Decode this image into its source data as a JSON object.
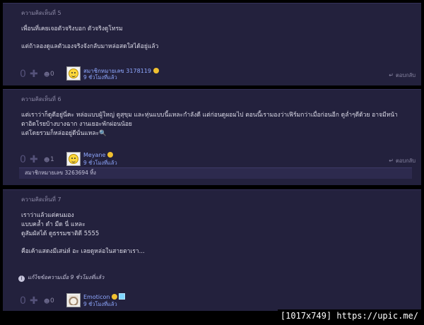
{
  "comments": [
    {
      "header": "ความคิดเห็นที่ 5",
      "lines": [
        "เพื่อนที่เคยเจอตัวจริงบอก ตัวจริงดูโทรม",
        "",
        "แต่ถ้าลองดูแลตัวเองจริงจังกลับมาหล่อสดใสได้อยู่แล้ว"
      ],
      "votes": "0",
      "emotion_count": "0",
      "username": "สมาชิกหมายเลข 3178119",
      "time": "9 ชั่วโมงที่แล้ว",
      "reply": "ตอบกลับ",
      "avatar": "smiley-avatar"
    },
    {
      "header": "ความคิดเห็นที่ 6",
      "lines": [
        "แต่เราว่าก็ดูดีอยู่นี่คะ หล่อแบบผู้ใหญ่ ดูสุขุม และหุ่นแบบนี้แหละกำลังดี แต่ก่อนดูผอมไป ตอนนี้เรามองว่าเฟิร์มกว่าเมื่อก่อนอีก ดูล่ำๆดีด้วย อาจมีหน้า",
        "ตาอิดโรยบ้างบางฉาก งานเยอะพักผ่อนน้อย",
        "แต่โดยรวมก็หล่ออยู่ดีนั่นแหละ🔍"
      ],
      "votes": "0",
      "emotion_count": "1",
      "username": "Meyane",
      "time": "9 ชั่วโมงที่แล้ว",
      "reply": "ตอบกลับ",
      "avatar": "smiley-avatar",
      "nested_reply": "สมาชิกหมายเลข 3263694 ทิ้ง"
    },
    {
      "header": "ความคิดเห็นที่ 7",
      "lines": [
        "เราว่าแล้วแต่คนมอง",
        "แบบคล้ำ ดำ มืด นี่ แหละ",
        "ดูสัมผัสได้ ดูธรรมชาติดี 5555",
        "",
        "คือเค้าแสดงมีเสน่ห์ อะ เลยดูหล่อในสายตาเรา..."
      ],
      "edited": "แก้ไขข้อความเมื่อ 9 ชั่วโมงที่แล้ว",
      "votes": "0",
      "emotion_count": "0",
      "username": "Emoticon",
      "time": "9 ชั่วโมงที่แล้ว",
      "reply": "ตอบกลับ",
      "avatar": "cat-avatar"
    }
  ],
  "watermark": "[1017x749] https://upic.me/"
}
